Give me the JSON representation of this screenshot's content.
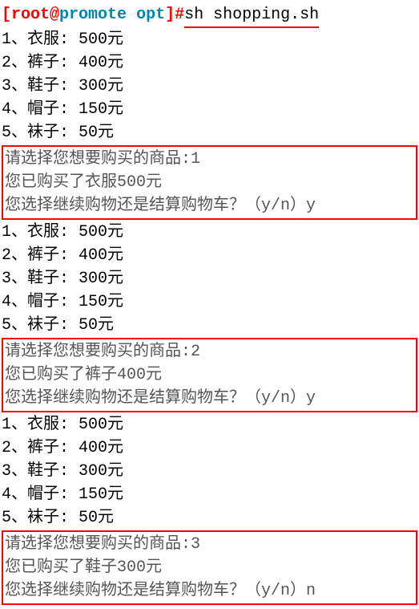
{
  "prompt": {
    "open_bracket": "[",
    "user": "root",
    "at": "@",
    "host": "promote",
    "space": " ",
    "path": "opt",
    "close_bracket": "]",
    "hash": "#",
    "command": "sh shopping.sh"
  },
  "menu": {
    "items": [
      "1、衣服: 500元",
      "2、裤子: 400元",
      "3、鞋子: 300元",
      "4、帽子: 150元",
      "5、袜子: 50元"
    ]
  },
  "interactions": [
    {
      "prompt_line": "请选择您想要购买的商品:1",
      "bought_line": "您已购买了衣服500元",
      "continue_line": "您选择继续购物还是结算购物车？（y/n）y"
    },
    {
      "prompt_line": "请选择您想要购买的商品:2",
      "bought_line": "您已购买了裤子400元",
      "continue_line": "您选择继续购物还是结算购物车？（y/n）y"
    },
    {
      "prompt_line": "请选择您想要购买的商品:3",
      "bought_line": "您已购买了鞋子300元",
      "continue_line": "您选择继续购物还是结算购物车？（y/n）n"
    }
  ]
}
